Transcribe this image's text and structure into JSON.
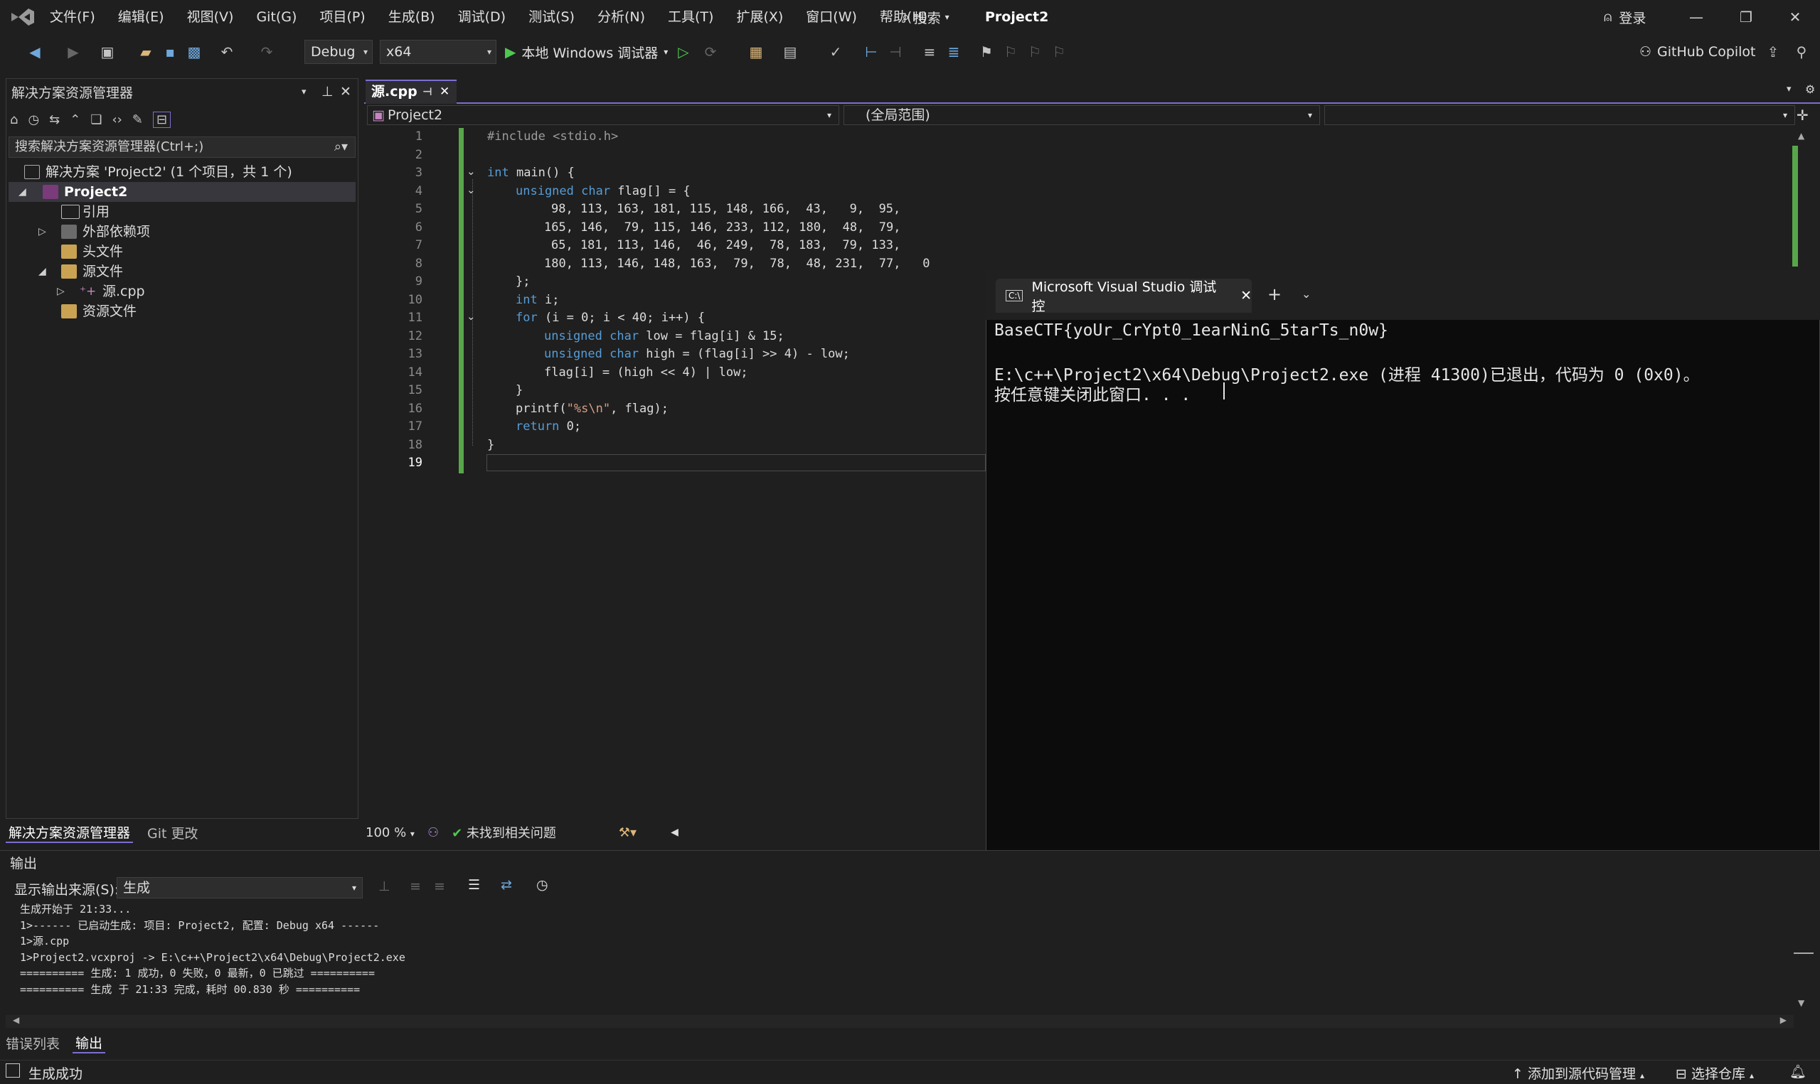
{
  "menu": {
    "items": [
      "文件(F)",
      "编辑(E)",
      "视图(V)",
      "Git(G)",
      "项目(P)",
      "生成(B)",
      "调试(D)",
      "测试(S)",
      "分析(N)",
      "工具(T)",
      "扩展(X)",
      "窗口(W)",
      "帮助(H)"
    ],
    "search_label": "搜索",
    "project_title": "Project2",
    "login_label": "登录"
  },
  "toolbar": {
    "config": "Debug",
    "platform": "x64",
    "run_label": "本地 Windows 调试器",
    "copilot_label": "GitHub Copilot"
  },
  "solution_explorer": {
    "title": "解决方案资源管理器",
    "search_placeholder": "搜索解决方案资源管理器(Ctrl+;)",
    "tree": {
      "solution": "解决方案 'Project2' (1 个项目，共 1 个)",
      "project": "Project2",
      "references": "引用",
      "external_deps": "外部依赖项",
      "headers": "头文件",
      "sources": "源文件",
      "source_file": "源.cpp",
      "resources": "资源文件"
    },
    "tabs": [
      "解决方案资源管理器",
      "Git 更改"
    ]
  },
  "editor": {
    "tab_label": "源.cpp",
    "nav_project": "Project2",
    "nav_scope": "(全局范围)",
    "line_numbers": [
      "1",
      "2",
      "3",
      "4",
      "5",
      "6",
      "7",
      "8",
      "9",
      "10",
      "11",
      "12",
      "13",
      "14",
      "15",
      "16",
      "17",
      "18",
      "19"
    ],
    "zoom": "100 %",
    "issues": "未找到相关问题",
    "code": {
      "l1": "#include <stdio.h>",
      "l5": "98, 113, 163, 181, 115, 148, 166,  43,   9,  95,",
      "l6": "165, 146,  79, 115, 146, 233, 112, 180,  48,  79,",
      "l7": "65, 181, 113, 146,  46, 249,  78, 183,  79, 133,",
      "l8": "180, 113, 146, 148, 163,  79,  78,  48, 231,  77,   0"
    }
  },
  "console": {
    "tab_title": "Microsoft Visual Studio 调试控",
    "line1": "BaseCTF{yoUr_CrYpt0_1earNinG_5tarTs_n0w}",
    "line2": "E:\\c++\\Project2\\x64\\Debug\\Project2.exe (进程 41300)已退出，代码为 0 (0x0)。",
    "line3": "按任意键关闭此窗口. . ."
  },
  "output": {
    "title": "输出",
    "source_label": "显示输出来源(S):",
    "source_value": "生成",
    "lines": [
      "生成开始于 21:33...",
      "1>------ 已启动生成: 项目: Project2, 配置: Debug x64 ------",
      "1>源.cpp",
      "1>Project2.vcxproj -> E:\\c++\\Project2\\x64\\Debug\\Project2.exe",
      "========== 生成: 1 成功，0 失败，0 最新，0 已跳过 ==========",
      "========== 生成 于 21:33 完成，耗时 00.830 秒 =========="
    ],
    "tabs": [
      "错误列表",
      "输出"
    ]
  },
  "status": {
    "left": "生成成功",
    "add_source": "添加到源代码管理",
    "select_repo": "选择仓库"
  },
  "colors": {
    "accent": "#7b6fd0",
    "keyword": "#569cd6",
    "string": "#d69d85",
    "change_bar": "#57a64a"
  }
}
